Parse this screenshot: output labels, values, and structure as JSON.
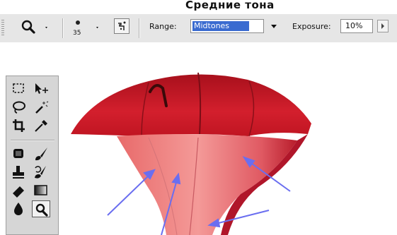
{
  "caption": {
    "text": "Средние тона"
  },
  "options_bar": {
    "brush_size": "35",
    "range_label": "Range:",
    "range_value": "Midtones",
    "exposure_label": "Exposure:",
    "exposure_value": "10%"
  },
  "toolbar_icons": [
    "rectangular-marquee-icon",
    "move-icon",
    "lasso-icon",
    "magic-wand-icon",
    "crop-icon",
    "eyedropper-icon",
    "healing-brush-icon",
    "brush-icon",
    "clone-stamp-icon",
    "history-brush-icon",
    "eraser-icon",
    "gradient-icon",
    "blur-icon",
    "sponge-icon"
  ],
  "colors": {
    "options_bar_bg": "#e6e6e6",
    "selection_blue": "#3a6bd0",
    "umbrella_red": "#c8202a",
    "annotation_arrow": "#6a6ef0"
  }
}
